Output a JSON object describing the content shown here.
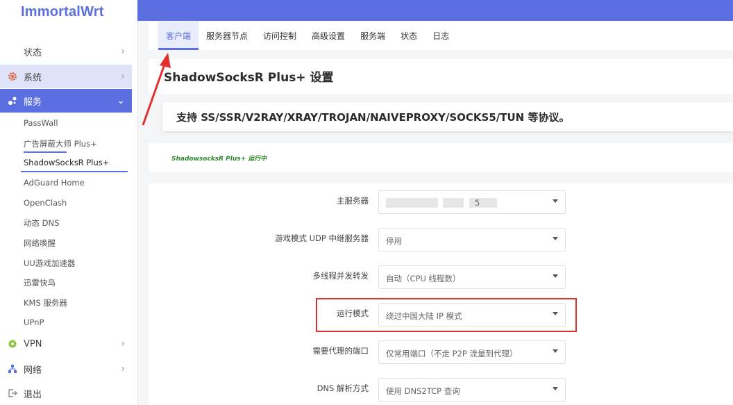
{
  "app": {
    "logo": "ImmortalWrt"
  },
  "sidebar": {
    "status": "状态",
    "system": "系统",
    "services": "服务",
    "vpn": "VPN",
    "network": "网络",
    "logout": "退出",
    "service_items": [
      "PassWall",
      "广告屏蔽大师 Plus+",
      "ShadowSocksR Plus+",
      "AdGuard Home",
      "OpenClash",
      "动态 DNS",
      "网络唤醒",
      "UU游戏加速器",
      "迅雷快鸟",
      "KMS 服务器",
      "UPnP"
    ]
  },
  "tabs": [
    "客户端",
    "服务器节点",
    "访问控制",
    "高级设置",
    "服务端",
    "状态",
    "日志"
  ],
  "page": {
    "title": "ShadowSocksR Plus+ 设置",
    "banner": "支持 SS/SSR/V2RAY/XRAY/TROJAN/NAIVEPROXY/SOCKS5/TUN 等协议。",
    "running": "ShadowsocksR Plus+ 运行中"
  },
  "form": [
    {
      "label": "主服务器",
      "value": "5"
    },
    {
      "label": "游戏模式 UDP 中继服务器",
      "value": "停用"
    },
    {
      "label": "多线程并发转发",
      "value": "自动（CPU 线程数）"
    },
    {
      "label": "运行模式",
      "value": "绕过中国大陆 IP 模式"
    },
    {
      "label": "需要代理的端口",
      "value": "仅常用端口（不走 P2P 流量到代理）"
    },
    {
      "label": "DNS 解析方式",
      "value": "使用 DNS2TCP 查询"
    }
  ],
  "colors": {
    "accent": "#5b6fe0",
    "highlight": "#e03030",
    "running": "#2e8b2e"
  }
}
